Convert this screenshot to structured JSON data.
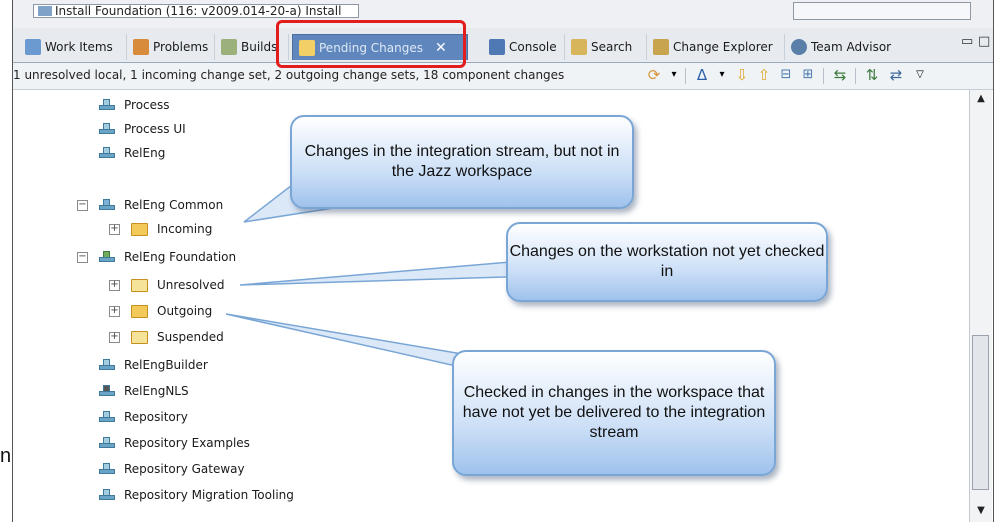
{
  "top": {
    "field_text": "Install Foundation (116: v2009.014-20-a) Install"
  },
  "tabs": [
    {
      "label": "Work Items",
      "icon": "work-items-icon",
      "active": false
    },
    {
      "label": "Problems",
      "icon": "problems-icon",
      "active": false
    },
    {
      "label": "Builds",
      "icon": "builds-icon",
      "active": false
    },
    {
      "label": "Pending Changes",
      "icon": "pending-changes-icon",
      "active": true
    },
    {
      "label": "Console",
      "icon": "console-icon",
      "active": false
    },
    {
      "label": "Search",
      "icon": "search-icon",
      "active": false
    },
    {
      "label": "Change Explorer",
      "icon": "change-explorer-icon",
      "active": false
    },
    {
      "label": "Team Advisor",
      "icon": "team-advisor-icon",
      "active": false
    }
  ],
  "status_text": "1 unresolved local, 1 incoming change set, 2 outgoing change sets, 18 component changes",
  "tree": [
    {
      "label": "Process"
    },
    {
      "label": "Process UI"
    },
    {
      "label": "RelEng"
    },
    {
      "label": "RelEng Common",
      "expander": "−"
    },
    {
      "label": "Incoming",
      "expander": "+"
    },
    {
      "label": "RelEng Foundation",
      "expander": "−"
    },
    {
      "label": "Unresolved",
      "expander": "+"
    },
    {
      "label": "Outgoing",
      "expander": "+"
    },
    {
      "label": "Suspended",
      "expander": "+"
    },
    {
      "label": "RelEngBuilder"
    },
    {
      "label": "RelEngNLS"
    },
    {
      "label": "Repository"
    },
    {
      "label": "Repository Examples"
    },
    {
      "label": "Repository Gateway"
    },
    {
      "label": "Repository Migration Tooling"
    }
  ],
  "callouts": {
    "incoming": "Changes in the integration stream, but not in the Jazz workspace",
    "unresolved": "Changes on the workstation not yet checked in",
    "outgoing": "Checked in changes in the workspace that have not yet be delivered to the integration stream"
  },
  "edge_text": "n",
  "colors": {
    "active_tab": "#5f87bd",
    "highlight_box": "#e21d1d",
    "callout_border": "#7aa6d6"
  }
}
